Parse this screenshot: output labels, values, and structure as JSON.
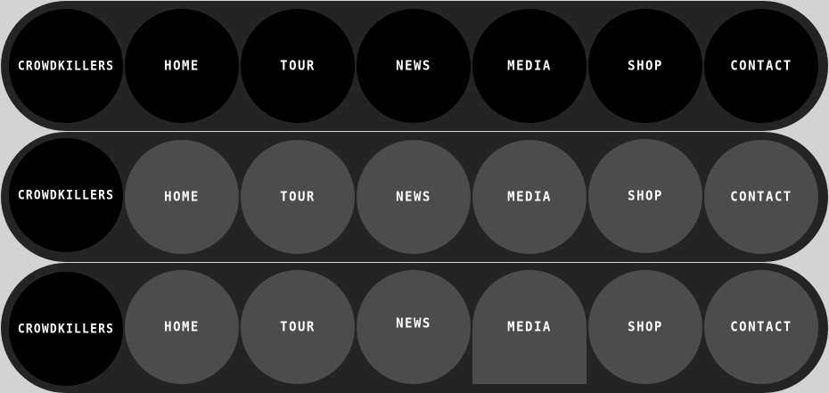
{
  "colors": {
    "page_background": "#d3d3d3",
    "bar_background": "#242424",
    "item_black": "#000000",
    "item_gray": "#4c4c4c",
    "text": "#ffffff"
  },
  "rows": [
    {
      "state": "default",
      "brand": "CROWDKILLERS",
      "items": [
        "HOME",
        "TOUR",
        "NEWS",
        "MEDIA",
        "SHOP",
        "CONTACT"
      ]
    },
    {
      "state": "hover",
      "brand": "CROWDKILLERS",
      "items": [
        "HOME",
        "TOUR",
        "NEWS",
        "MEDIA",
        "SHOP",
        "CONTACT"
      ]
    },
    {
      "state": "active-media",
      "brand": "CROWDKILLERS",
      "items": [
        "HOME",
        "TOUR",
        "NEWS",
        "MEDIA",
        "SHOP",
        "CONTACT"
      ]
    }
  ]
}
